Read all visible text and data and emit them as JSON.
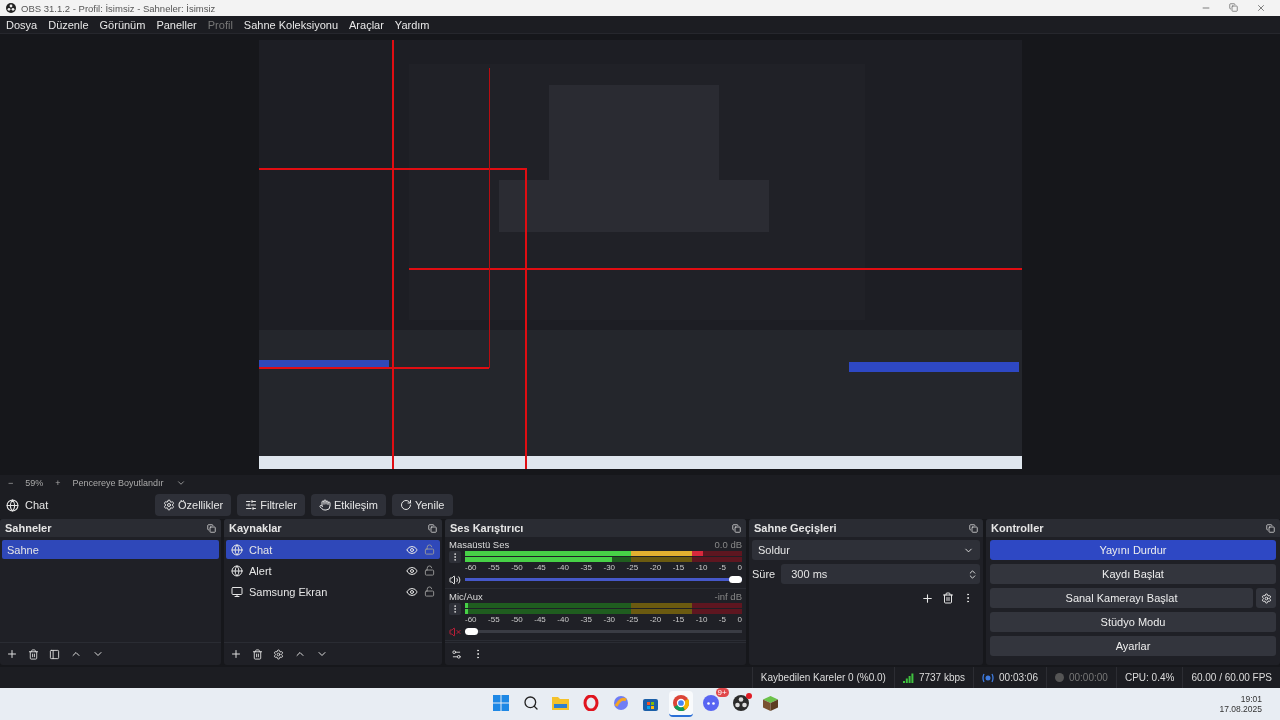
{
  "window": {
    "title": "OBS 31.1.2 - Profil: İsimsiz - Sahneler: İsimsiz"
  },
  "menu": [
    {
      "label": "Dosya",
      "disabled": false
    },
    {
      "label": "Düzenle",
      "disabled": false
    },
    {
      "label": "Görünüm",
      "disabled": false
    },
    {
      "label": "Paneller",
      "disabled": false
    },
    {
      "label": "Profil",
      "disabled": true
    },
    {
      "label": "Sahne Koleksiyonu",
      "disabled": false
    },
    {
      "label": "Araçlar",
      "disabled": false
    },
    {
      "label": "Yardım",
      "disabled": false
    }
  ],
  "zoom_bar": {
    "minus": "−",
    "zoom": "59%",
    "plus": "+",
    "mode": "Pencereye Boyutlandır"
  },
  "source_toolbar": {
    "source": "Chat",
    "buttons": [
      {
        "kind": "properties",
        "label": "Özellikler"
      },
      {
        "kind": "filters",
        "label": "Filtreler"
      },
      {
        "kind": "interact",
        "label": "Etkileşim"
      },
      {
        "kind": "refresh",
        "label": "Yenile"
      }
    ]
  },
  "scenes": {
    "title": "Sahneler",
    "items": [
      {
        "name": "Sahne",
        "selected": true
      }
    ]
  },
  "sources": {
    "title": "Kaynaklar",
    "items": [
      {
        "name": "Chat",
        "kind": "browser",
        "selected": true,
        "visible": true,
        "locked": false
      },
      {
        "name": "Alert",
        "kind": "browser",
        "selected": false,
        "visible": true,
        "locked": false
      },
      {
        "name": "Samsung Ekran",
        "kind": "display",
        "selected": false,
        "visible": true,
        "locked": false
      }
    ]
  },
  "mixer": {
    "title": "Ses Karıştırıcı",
    "channels": [
      {
        "name": "Masaüstü Ses",
        "reading": "0.0 dB",
        "muted": false,
        "meters": [
          {
            "level": 0.86
          },
          {
            "level": 0.53
          }
        ],
        "scale": [
          "-60",
          "-55",
          "-50",
          "-45",
          "-40",
          "-35",
          "-30",
          "-25",
          "-20",
          "-15",
          "-10",
          "-5",
          "0"
        ],
        "volume": {
          "level": 1
        }
      },
      {
        "name": "Mic/Aux",
        "reading": "-inf dB",
        "muted": true,
        "meters": [
          {
            "level": 0.01
          },
          {
            "level": 0.01
          }
        ],
        "scale": [
          "-60",
          "-55",
          "-50",
          "-45",
          "-40",
          "-35",
          "-30",
          "-25",
          "-20",
          "-15",
          "-10",
          "-5",
          "0"
        ],
        "volume": {
          "level": 0
        }
      }
    ]
  },
  "transitions": {
    "title": "Sahne Geçişleri",
    "transition": "Soldur",
    "duration_label": "Süre",
    "duration": "300 ms"
  },
  "controls": {
    "title": "Kontroller",
    "buttons": [
      {
        "label": "Yayını Durdur",
        "active": true,
        "has_settings": false
      },
      {
        "label": "Kaydı Başlat",
        "active": false,
        "has_settings": false
      },
      {
        "label": "Sanal Kamerayı Başlat",
        "active": false,
        "has_settings": true
      },
      {
        "label": "Stüdyo Modu",
        "active": false,
        "has_settings": false
      },
      {
        "label": "Ayarlar",
        "active": false,
        "has_settings": false
      }
    ]
  },
  "status_bar": [
    {
      "kind": "dropped",
      "text": "Kaybedilen Kareler 0 (%0.0)"
    },
    {
      "kind": "bitrate",
      "text": "7737 kbps"
    },
    {
      "kind": "stream",
      "text": "00:03:06",
      "live": true
    },
    {
      "kind": "record",
      "text": "00:00:00",
      "live": false
    },
    {
      "kind": "cpu",
      "text": "CPU: 0.4%"
    },
    {
      "kind": "fps",
      "text": "60.00 / 60.00 FPS"
    }
  ],
  "taskbar": {
    "apps": [
      {
        "kind": "start",
        "active": false
      },
      {
        "kind": "search",
        "active": false
      },
      {
        "kind": "files",
        "active": false
      },
      {
        "kind": "opera",
        "active": false
      },
      {
        "kind": "copilot",
        "active": false
      },
      {
        "kind": "store",
        "active": false
      },
      {
        "kind": "chrome",
        "active": true
      },
      {
        "kind": "discord",
        "active": false,
        "badge": "9+"
      },
      {
        "kind": "obs",
        "active": false
      },
      {
        "kind": "minecraft",
        "active": false
      }
    ],
    "time": "19:01",
    "date": "17.08.2025"
  }
}
